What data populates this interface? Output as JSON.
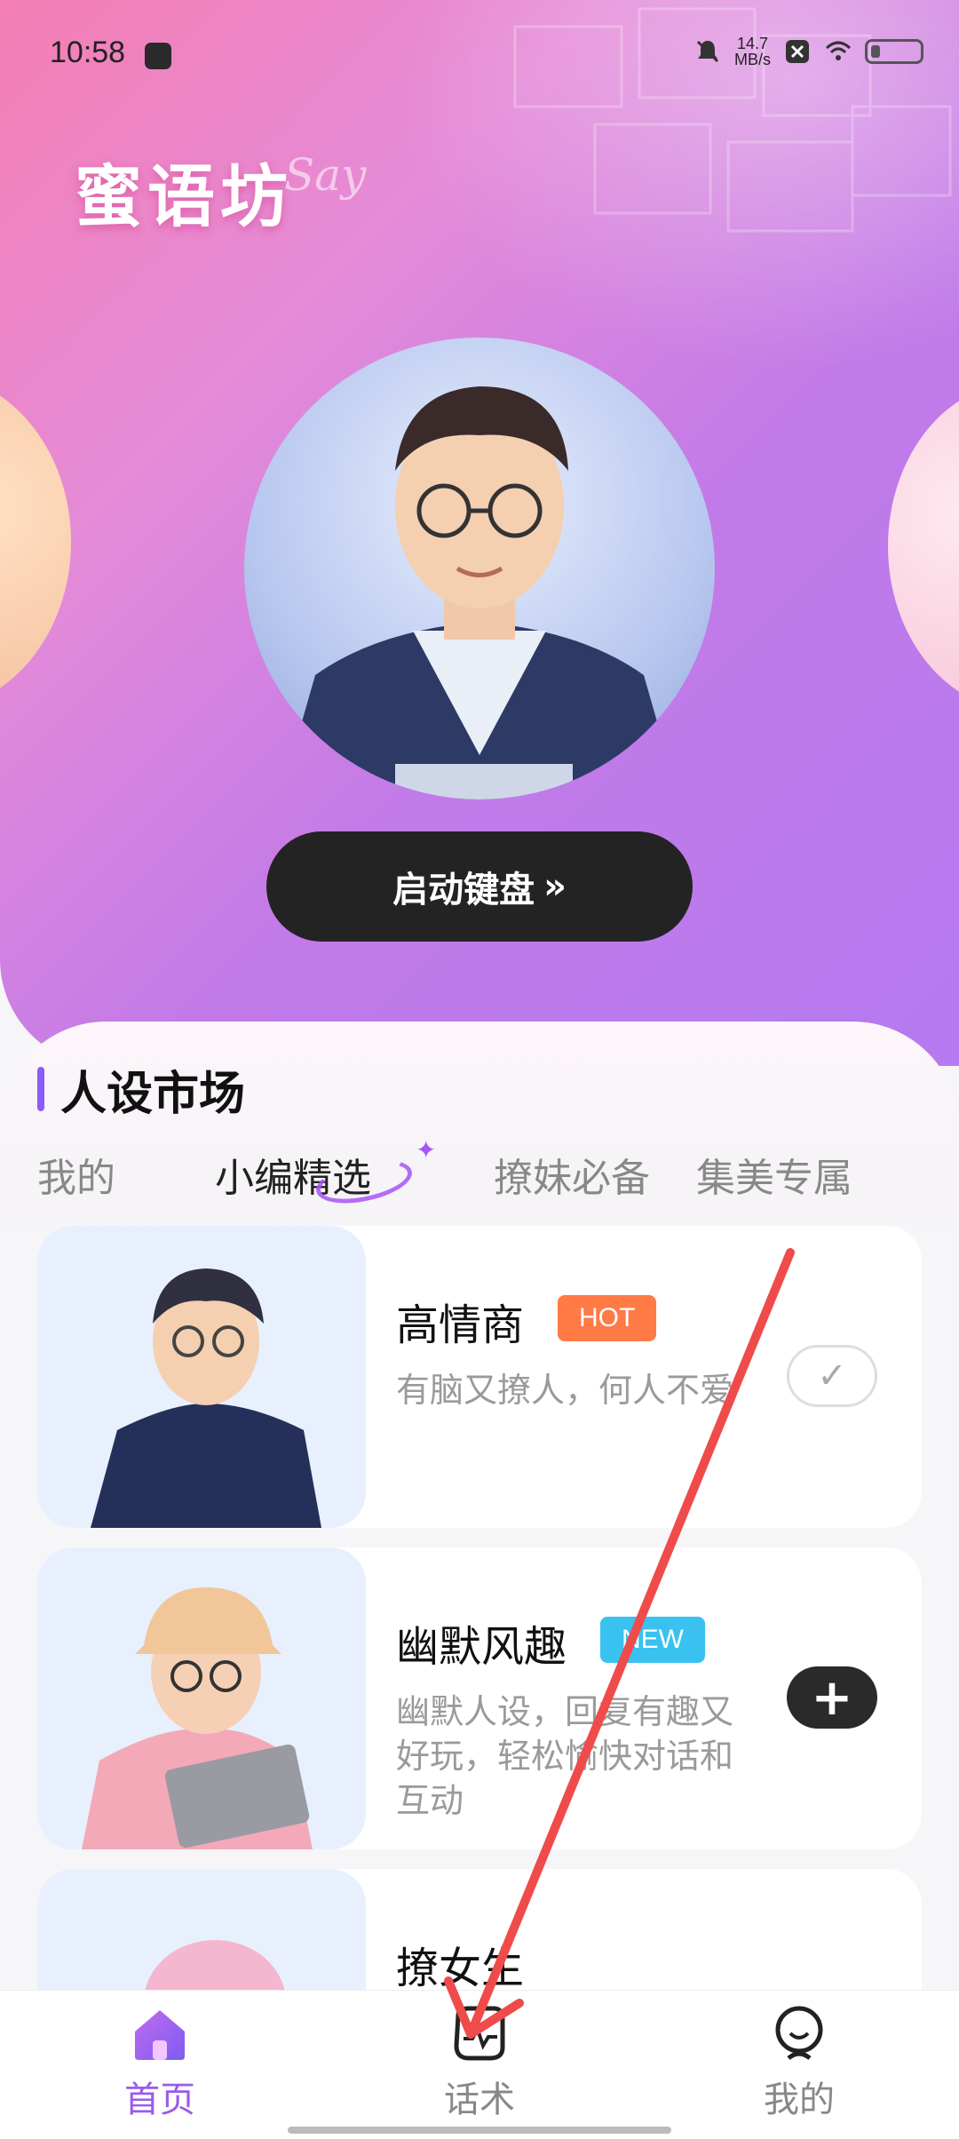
{
  "status_bar": {
    "time": "10:58",
    "speed_value": "14.7",
    "speed_unit": "MB/s"
  },
  "brand": {
    "name": "蜜语坊",
    "tagline": "Say"
  },
  "hero": {
    "launch_label": "启动键盘",
    "launch_icon": "double-chevron-right-icon"
  },
  "market": {
    "title": "人设市场",
    "tabs": [
      {
        "label": "我的",
        "active": false
      },
      {
        "label": "小编精选",
        "active": true
      },
      {
        "label": "撩妹必备",
        "active": false
      },
      {
        "label": "集美专属",
        "active": false
      }
    ],
    "cards": [
      {
        "name": "高情商",
        "badge": "HOT",
        "badge_color": "#ff7a45",
        "desc": "有脑又撩人，何人不爱",
        "state": "added",
        "action_icon": "check-icon"
      },
      {
        "name": "幽默风趣",
        "badge": "NEW",
        "badge_color": "#39c2f0",
        "desc": "幽默人设，回复有趣又好玩，轻松愉快对话和互动",
        "state": "add",
        "action_icon": "plus-icon"
      },
      {
        "name": "撩女生",
        "badge": "",
        "badge_color": "",
        "desc": "",
        "state": "",
        "action_icon": ""
      }
    ]
  },
  "bottom_nav": {
    "items": [
      {
        "label": "首页",
        "icon": "home-icon",
        "active": true
      },
      {
        "label": "话术",
        "icon": "chat-bubble-icon",
        "active": false
      },
      {
        "label": "我的",
        "icon": "profile-icon",
        "active": false
      }
    ]
  },
  "colors": {
    "accent": "#9a5be8",
    "hero_start": "#f47fb4",
    "hero_end": "#b57af0",
    "annotation_arrow": "#ef4b4b"
  }
}
